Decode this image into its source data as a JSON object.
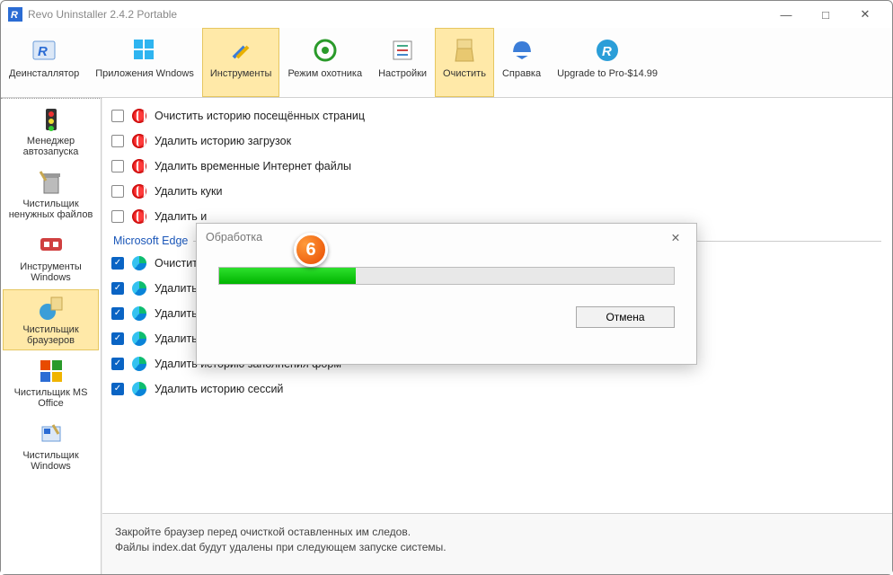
{
  "window": {
    "title": "Revo Uninstaller 2.4.2 Portable"
  },
  "toolbar": [
    {
      "name": "uninstaller",
      "label": "Деинсталлятор",
      "sel": false
    },
    {
      "name": "win-apps",
      "label": "Приложения Wndows",
      "sel": false
    },
    {
      "name": "tools",
      "label": "Инструменты",
      "sel": true
    },
    {
      "name": "hunter",
      "label": "Режим охотника",
      "sel": false
    },
    {
      "name": "settings",
      "label": "Настройки",
      "sel": false
    },
    {
      "name": "clean",
      "label": "Очистить",
      "sel": true
    },
    {
      "name": "help",
      "label": "Справка",
      "sel": false
    },
    {
      "name": "upgrade",
      "label": "Upgrade to Pro-$14.99",
      "sel": false
    }
  ],
  "sidebar": [
    {
      "name": "autorun",
      "label": "Менеджер автозапуска",
      "sel": false
    },
    {
      "name": "junk",
      "label": "Чистильщик ненужных файлов",
      "sel": false
    },
    {
      "name": "wintools",
      "label": "Инструменты Windows",
      "sel": false
    },
    {
      "name": "browsers",
      "label": "Чистильщик браузеров",
      "sel": true
    },
    {
      "name": "msoffice",
      "label": "Чистильщик MS Office",
      "sel": false
    },
    {
      "name": "wincleaner",
      "label": "Чистильщик Windows",
      "sel": false
    }
  ],
  "list": {
    "opera": [
      {
        "label": "Очистить историю посещённых страниц",
        "checked": false
      },
      {
        "label": "Удалить историю загрузок",
        "checked": false
      },
      {
        "label": "Удалить временные Интернет файлы",
        "checked": false
      },
      {
        "label": "Удалить куки",
        "checked": false
      },
      {
        "label": "Удалить и",
        "checked": false
      }
    ],
    "edge_group": "Microsoft Edge",
    "edge": [
      {
        "label": "Очистить",
        "checked": true
      },
      {
        "label": "Удалить в",
        "checked": true
      },
      {
        "label": "Удалить куки",
        "checked": true
      },
      {
        "label": "Удалить историю загрузок",
        "checked": true
      },
      {
        "label": "Удалить историю заполнения форм",
        "checked": true
      },
      {
        "label": "Удалить историю сессий",
        "checked": true
      }
    ]
  },
  "status": {
    "line1": "Закройте браузер перед очисткой оставленных им следов.",
    "line2": "Файлы index.dat будут удалены при следующем запуске системы."
  },
  "dialog": {
    "title": "Обработка",
    "progress_pct": 30,
    "cancel": "Отмена"
  },
  "badge": "6"
}
